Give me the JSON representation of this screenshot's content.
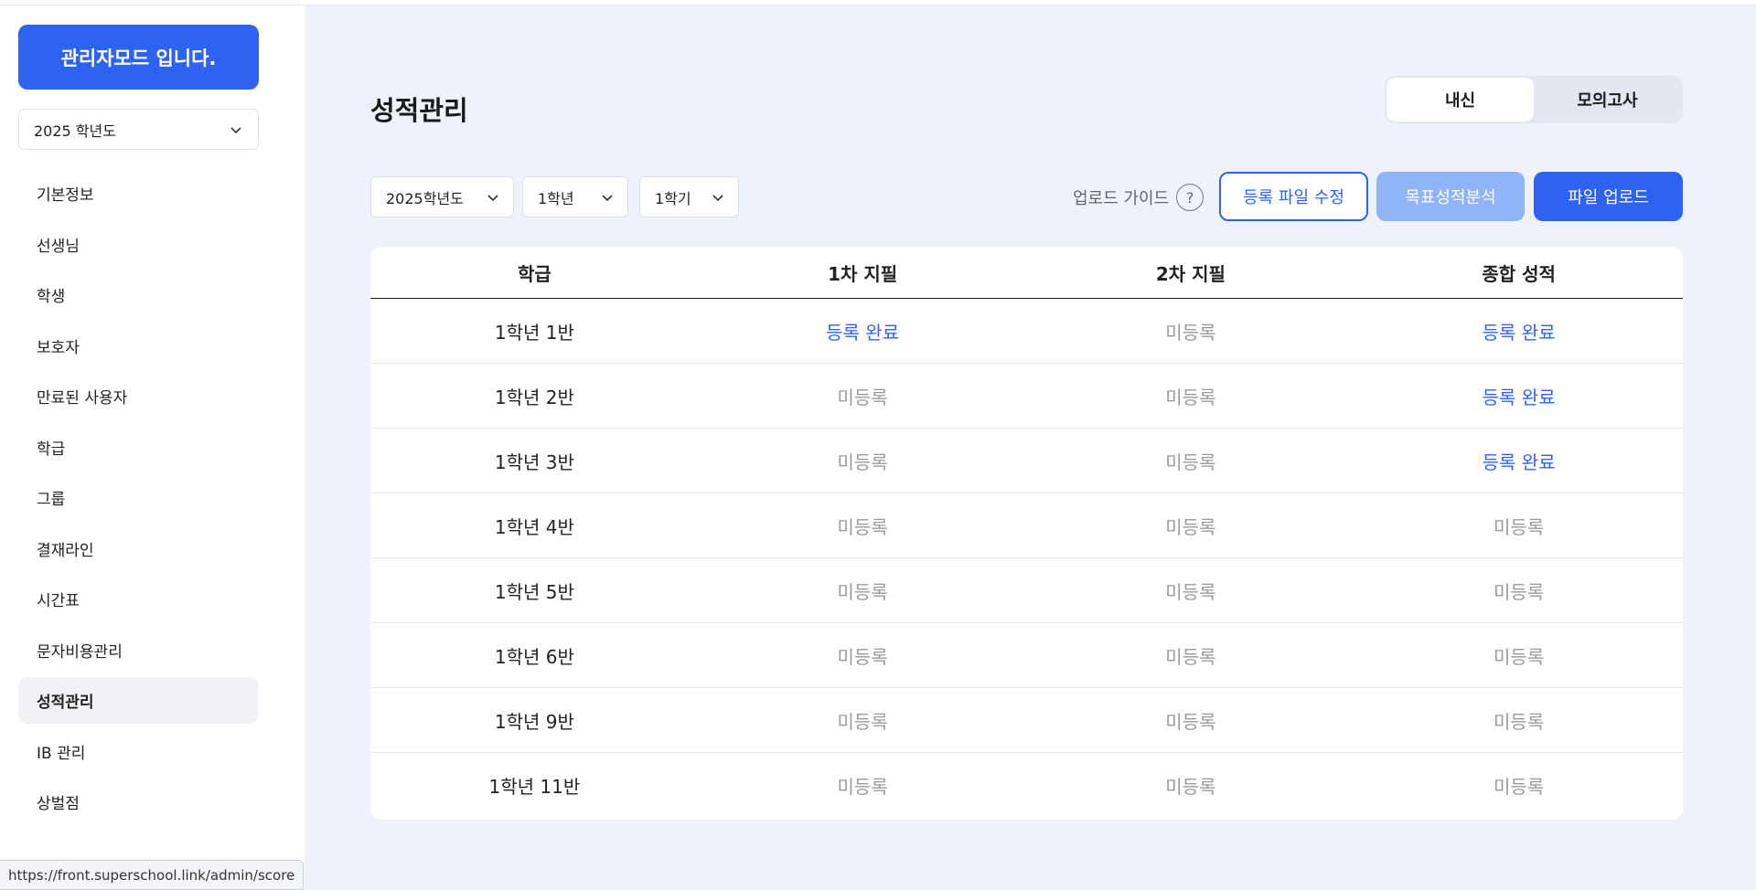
{
  "sidebar": {
    "admin_label": "관리자모드 입니다.",
    "year_select": "2025 학년도",
    "items": [
      {
        "label": "기본정보",
        "active": false
      },
      {
        "label": "선생님",
        "active": false
      },
      {
        "label": "학생",
        "active": false
      },
      {
        "label": "보호자",
        "active": false
      },
      {
        "label": "만료된 사용자",
        "active": false
      },
      {
        "label": "학급",
        "active": false
      },
      {
        "label": "그룹",
        "active": false
      },
      {
        "label": "결재라인",
        "active": false
      },
      {
        "label": "시간표",
        "active": false
      },
      {
        "label": "문자비용관리",
        "active": false
      },
      {
        "label": "성적관리",
        "active": true
      },
      {
        "label": "IB 관리",
        "active": false
      },
      {
        "label": "상벌점",
        "active": false
      }
    ]
  },
  "status_url": "https://front.superschool.link/admin/score",
  "main": {
    "title": "성적관리",
    "tabs": [
      {
        "label": "내신",
        "selected": true
      },
      {
        "label": "모의고사",
        "selected": false
      }
    ],
    "filters": {
      "year": "2025학년도",
      "grade": "1학년",
      "semester": "1학기"
    },
    "upload_guide": "업로드 가이드",
    "guide_icon": "?",
    "buttons": {
      "edit_file": "등록 파일 수정",
      "target_analysis": "목표성적분석",
      "upload_file": "파일 업로드"
    },
    "table": {
      "headers": [
        "학급",
        "1차 지필",
        "2차 지필",
        "종합 성적"
      ],
      "rows": [
        [
          "1학년 1반",
          "등록 완료",
          "미등록",
          "등록 완료"
        ],
        [
          "1학년 2반",
          "미등록",
          "미등록",
          "등록 완료"
        ],
        [
          "1학년 3반",
          "미등록",
          "미등록",
          "등록 완료"
        ],
        [
          "1학년 4반",
          "미등록",
          "미등록",
          "미등록"
        ],
        [
          "1학년 5반",
          "미등록",
          "미등록",
          "미등록"
        ],
        [
          "1학년 6반",
          "미등록",
          "미등록",
          "미등록"
        ],
        [
          "1학년 9반",
          "미등록",
          "미등록",
          "미등록"
        ],
        [
          "1학년 11반",
          "미등록",
          "미등록",
          "미등록"
        ]
      ]
    }
  },
  "colors": {
    "primary": "#2d63f0",
    "primary_light": "#8fb4f7",
    "main_bg": "#eef2fb",
    "registered": "#2d63f0",
    "unregistered": "#9a9a9a"
  }
}
